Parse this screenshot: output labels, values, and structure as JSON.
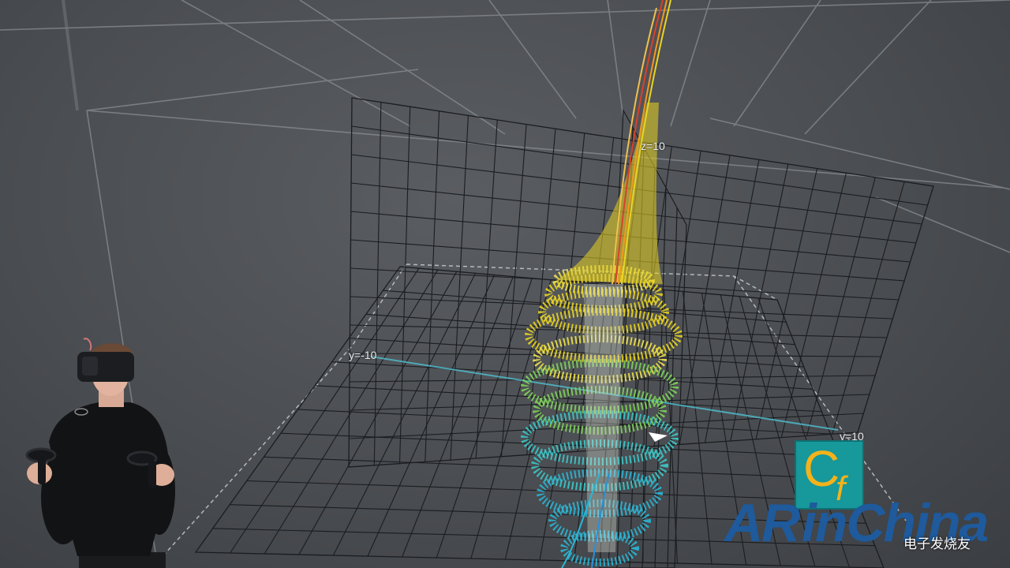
{
  "axis_labels": {
    "z_top": "z=10",
    "y_negative": "y=-10",
    "y_positive": "y=10"
  },
  "watermark": {
    "logo_letters": {
      "c": "C",
      "f": "f"
    },
    "wordmark_a": "AR",
    "wordmark_b": "inChina",
    "source_text": "电子发烧友",
    "colors": {
      "teal": "#17989a",
      "gold": "#f3b21b",
      "blue": "#1e5a9c"
    }
  },
  "surface_colors": [
    "#d9412a",
    "#f29a1f",
    "#e9d420",
    "#f0e24b",
    "#7fd35a",
    "#3cc9c9",
    "#2ab6d6"
  ]
}
